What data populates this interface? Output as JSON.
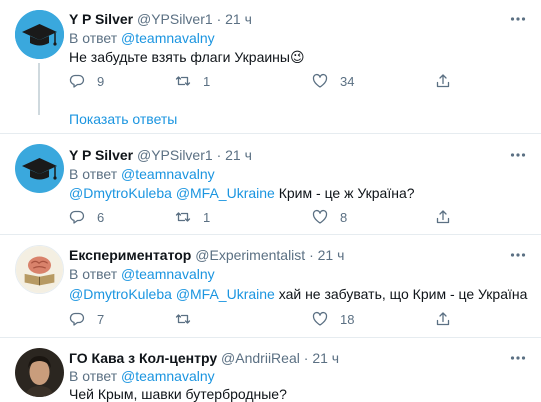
{
  "tweets": [
    {
      "name": "Y P Silver",
      "handle": "@YPSilver1",
      "dot": "·",
      "time": "21 ч",
      "reply_prefix": "В ответ",
      "reply_to": "@teamnavalny",
      "text": "Не забудьте взять флаги Украины",
      "emoji": "😉",
      "replies": "9",
      "retweets": "1",
      "likes": "34"
    },
    {
      "name": "Y P Silver",
      "handle": "@YPSilver1",
      "dot": "·",
      "time": "21 ч",
      "reply_prefix": "В ответ",
      "reply_to": "@teamnavalny",
      "mention1": "@DmytroKuleba",
      "mention2": "@MFA_Ukraine",
      "text": "Крим - це ж Україна?",
      "replies": "6",
      "retweets": "1",
      "likes": "8"
    },
    {
      "name": "Експериментатор",
      "handle": "@Experimentalist",
      "dot": "·",
      "time": "21 ч",
      "reply_prefix": "В ответ",
      "reply_to": "@teamnavalny",
      "mention1": "@DmytroKuleba",
      "mention2": "@MFA_Ukraine",
      "text": "хай не забувать, що Крим - це Україна",
      "replies": "7",
      "retweets": "",
      "likes": "18"
    },
    {
      "name": "ГО Кава з Кол-центру",
      "handle": "@AndriiReal",
      "dot": "·",
      "time": "21 ч",
      "reply_prefix": "В ответ",
      "reply_to": "@teamnavalny",
      "text": "Чей Крым, шавки бутербродные?"
    }
  ],
  "show_replies": "Показать ответы",
  "icons": [
    "graduation-cap-avatar",
    "brain-book-avatar",
    "portrait-avatar",
    "more-icon",
    "reply-icon",
    "retweet-icon",
    "like-icon",
    "share-icon"
  ],
  "colors": {
    "link": "#1b95e0",
    "secondary": "#5b7083",
    "divider": "#e6ecf0",
    "thread": "#cfd9de"
  }
}
